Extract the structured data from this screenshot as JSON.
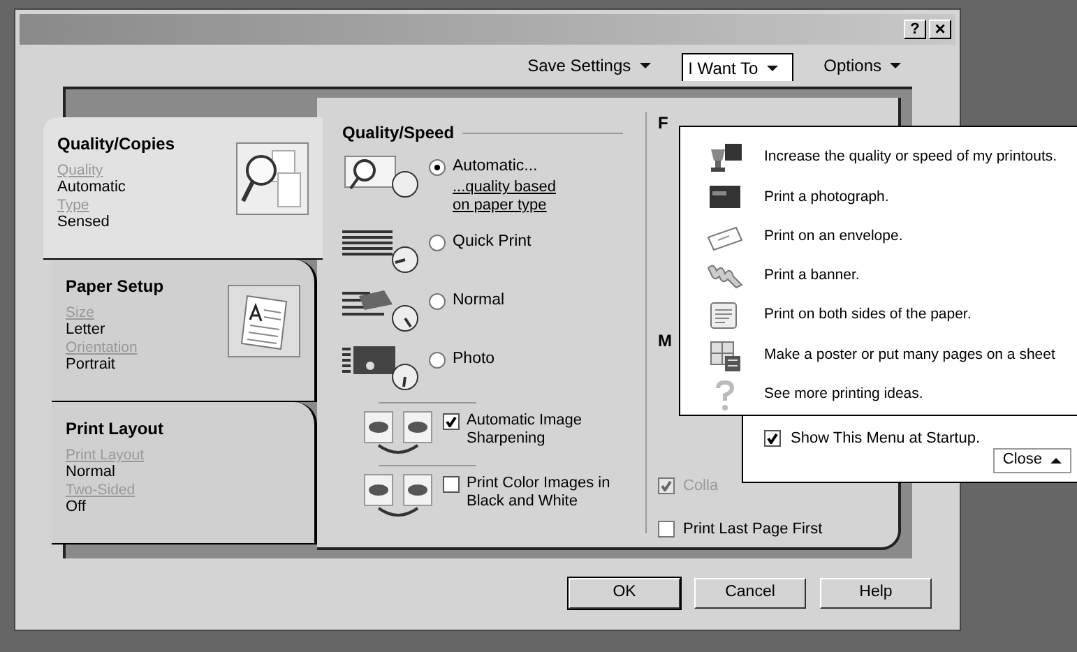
{
  "window": {
    "help_button": "?",
    "close_button": "×"
  },
  "toolbar": [
    {
      "label": "Save Settings",
      "selected": false
    },
    {
      "label": "I Want To",
      "selected": true
    },
    {
      "label": "Options",
      "selected": false
    }
  ],
  "tabs": [
    {
      "title": "Quality/Copies",
      "selected": true,
      "kind": "quality",
      "fields": [
        {
          "label": "Quality",
          "value": "Automatic"
        },
        {
          "label": "Type",
          "value": "Sensed"
        }
      ]
    },
    {
      "title": "Paper Setup",
      "selected": false,
      "kind": "paper",
      "fields": [
        {
          "label": "Size",
          "value": "Letter"
        },
        {
          "label": "Orientation",
          "value": "Portrait"
        }
      ]
    },
    {
      "title": "Print Layout",
      "selected": false,
      "kind": "none",
      "fields": [
        {
          "label": "Print Layout",
          "value": "Normal"
        },
        {
          "label": "Two-Sided",
          "value": "Off"
        }
      ]
    }
  ],
  "quality_speed": {
    "title": "Quality/Speed",
    "options": [
      {
        "label": "Automatic...",
        "selected": true,
        "kind": "automatic",
        "link": "...quality based on paper type"
      },
      {
        "label": "Quick Print",
        "selected": false,
        "kind": "quick"
      },
      {
        "label": "Normal",
        "selected": false,
        "kind": "normal"
      },
      {
        "label": "Photo",
        "selected": false,
        "kind": "photo"
      }
    ],
    "checkboxes": [
      {
        "label": "Automatic Image Sharpening",
        "checked": true
      },
      {
        "label": "Print Color Images in Black and White",
        "checked": false
      }
    ]
  },
  "right_panel": {
    "headings": [
      "F",
      "M"
    ],
    "checkboxes": [
      {
        "label": "Colla",
        "checked": true,
        "disabled": true
      },
      {
        "label": "Print Last Page First",
        "checked": false,
        "disabled": false
      }
    ]
  },
  "menu": {
    "items": [
      {
        "label": "Increase the quality or speed of my printouts.",
        "kind": "quality"
      },
      {
        "label": "Print a photograph.",
        "kind": "photo"
      },
      {
        "label": "Print on an envelope.",
        "kind": "envelope"
      },
      {
        "label": "Print a banner.",
        "kind": "banner"
      },
      {
        "label": "Print on both sides of the paper.",
        "kind": "duplex"
      },
      {
        "label": "Make a poster or put many pages on a sheet",
        "kind": "poster"
      },
      {
        "label": "See more printing ideas.",
        "kind": "ideas"
      }
    ],
    "startup": {
      "label": "Show This Menu at Startup.",
      "checked": true
    },
    "close_button": "Close"
  },
  "buttons": [
    "OK",
    "Cancel",
    "Help"
  ]
}
